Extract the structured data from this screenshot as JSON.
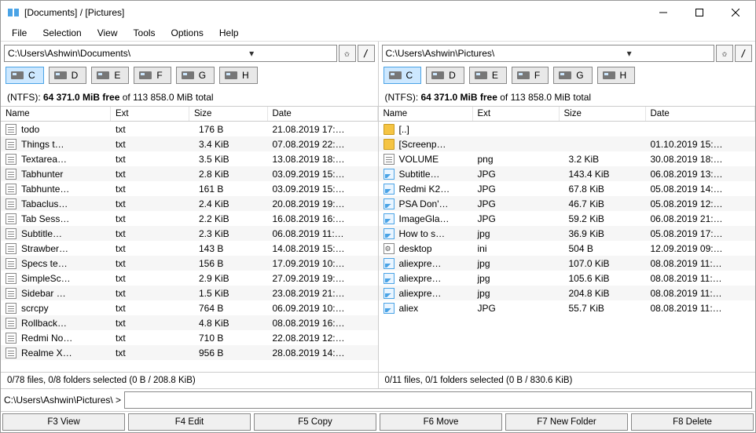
{
  "window": {
    "title": "[Documents] / [Pictures]"
  },
  "menubar": [
    "File",
    "Selection",
    "View",
    "Tools",
    "Options",
    "Help"
  ],
  "drives": [
    "C",
    "D",
    "E",
    "F",
    "G",
    "H"
  ],
  "free_prefix": "(NTFS): ",
  "free_bold": "64 371.0 MiB free",
  "free_suffix": " of 113 858.0 MiB total",
  "columns": [
    "Name",
    "Ext",
    "Size",
    "Date"
  ],
  "left": {
    "path": "C:\\Users\\Ashwin\\Documents\\",
    "selection": "0/78 files, 0/8 folders selected (0 B / 208.8 KiB)",
    "rows": [
      {
        "ic": "txt",
        "name": "todo",
        "ext": "txt",
        "size": "176 B",
        "date": "21.08.2019 17:…"
      },
      {
        "ic": "txt",
        "name": "Things t…",
        "ext": "txt",
        "size": "3.4 KiB",
        "date": "07.08.2019 22:…"
      },
      {
        "ic": "txt",
        "name": "Textarea…",
        "ext": "txt",
        "size": "3.5 KiB",
        "date": "13.08.2019 18:…"
      },
      {
        "ic": "txt",
        "name": "Tabhunter",
        "ext": "txt",
        "size": "2.8 KiB",
        "date": "03.09.2019 15:…"
      },
      {
        "ic": "txt",
        "name": "Tabhunte…",
        "ext": "txt",
        "size": "161 B",
        "date": "03.09.2019 15:…"
      },
      {
        "ic": "txt",
        "name": "Tabaclus…",
        "ext": "txt",
        "size": "2.4 KiB",
        "date": "20.08.2019 19:…"
      },
      {
        "ic": "txt",
        "name": "Tab Sess…",
        "ext": "txt",
        "size": "2.2 KiB",
        "date": "16.08.2019 16:…"
      },
      {
        "ic": "txt",
        "name": "Subtitle…",
        "ext": "txt",
        "size": "2.3 KiB",
        "date": "06.08.2019 11:…"
      },
      {
        "ic": "txt",
        "name": "Strawber…",
        "ext": "txt",
        "size": "143 B",
        "date": "14.08.2019 15:…"
      },
      {
        "ic": "txt",
        "name": "Specs te…",
        "ext": "txt",
        "size": "156 B",
        "date": "17.09.2019 10:…"
      },
      {
        "ic": "txt",
        "name": "SimpleSc…",
        "ext": "txt",
        "size": "2.9 KiB",
        "date": "27.09.2019 19:…"
      },
      {
        "ic": "txt",
        "name": "Sidebar …",
        "ext": "txt",
        "size": "1.5 KiB",
        "date": "23.08.2019 21:…"
      },
      {
        "ic": "txt",
        "name": "scrcpy",
        "ext": "txt",
        "size": "764 B",
        "date": "06.09.2019 10:…"
      },
      {
        "ic": "txt",
        "name": "Rollback…",
        "ext": "txt",
        "size": "4.8 KiB",
        "date": "08.08.2019 16:…"
      },
      {
        "ic": "txt",
        "name": "Redmi No…",
        "ext": "txt",
        "size": "710 B",
        "date": "22.08.2019 12:…"
      },
      {
        "ic": "txt",
        "name": "Realme X…",
        "ext": "txt",
        "size": "956 B",
        "date": "28.08.2019 14:…"
      }
    ]
  },
  "right": {
    "path": "C:\\Users\\Ashwin\\Pictures\\",
    "selection": "0/11 files, 0/1 folders selected (0 B / 830.6 KiB)",
    "rows": [
      {
        "ic": "fold",
        "name": "[..]",
        "ext": "",
        "size": "",
        "date": ""
      },
      {
        "ic": "fold",
        "name": "[Screenp…",
        "ext": "",
        "size": "",
        "date": "01.10.2019 15:…"
      },
      {
        "ic": "txt",
        "name": "VOLUME",
        "ext": "png",
        "size": "3.2 KiB",
        "date": "30.08.2019 18:…"
      },
      {
        "ic": "img",
        "name": "Subtitle…",
        "ext": "JPG",
        "size": "143.4 KiB",
        "date": "06.08.2019 13:…"
      },
      {
        "ic": "img",
        "name": "Redmi K2…",
        "ext": "JPG",
        "size": "67.8 KiB",
        "date": "05.08.2019 14:…"
      },
      {
        "ic": "img",
        "name": "PSA Don'…",
        "ext": "JPG",
        "size": "46.7 KiB",
        "date": "05.08.2019 12:…"
      },
      {
        "ic": "img",
        "name": "ImageGla…",
        "ext": "JPG",
        "size": "59.2 KiB",
        "date": "06.08.2019 21:…"
      },
      {
        "ic": "img",
        "name": "How to s…",
        "ext": "jpg",
        "size": "36.9 KiB",
        "date": "05.08.2019 17:…"
      },
      {
        "ic": "ini",
        "name": "desktop",
        "ext": "ini",
        "size": "504 B",
        "date": "12.09.2019 09:…"
      },
      {
        "ic": "img",
        "name": "aliexpre…",
        "ext": "jpg",
        "size": "107.0 KiB",
        "date": "08.08.2019 11:…"
      },
      {
        "ic": "img",
        "name": "aliexpre…",
        "ext": "jpg",
        "size": "105.6 KiB",
        "date": "08.08.2019 11:…"
      },
      {
        "ic": "img",
        "name": "aliexpre…",
        "ext": "jpg",
        "size": "204.8 KiB",
        "date": "08.08.2019 11:…"
      },
      {
        "ic": "img",
        "name": "aliex",
        "ext": "JPG",
        "size": "55.7 KiB",
        "date": "08.08.2019 11:…"
      }
    ]
  },
  "cmd_prompt": "C:\\Users\\Ashwin\\Pictures\\ >",
  "fn_buttons": [
    "F3 View",
    "F4 Edit",
    "F5 Copy",
    "F6 Move",
    "F7 New Folder",
    "F8 Delete"
  ],
  "star_glyph": "✩",
  "slash_glyph": "/"
}
